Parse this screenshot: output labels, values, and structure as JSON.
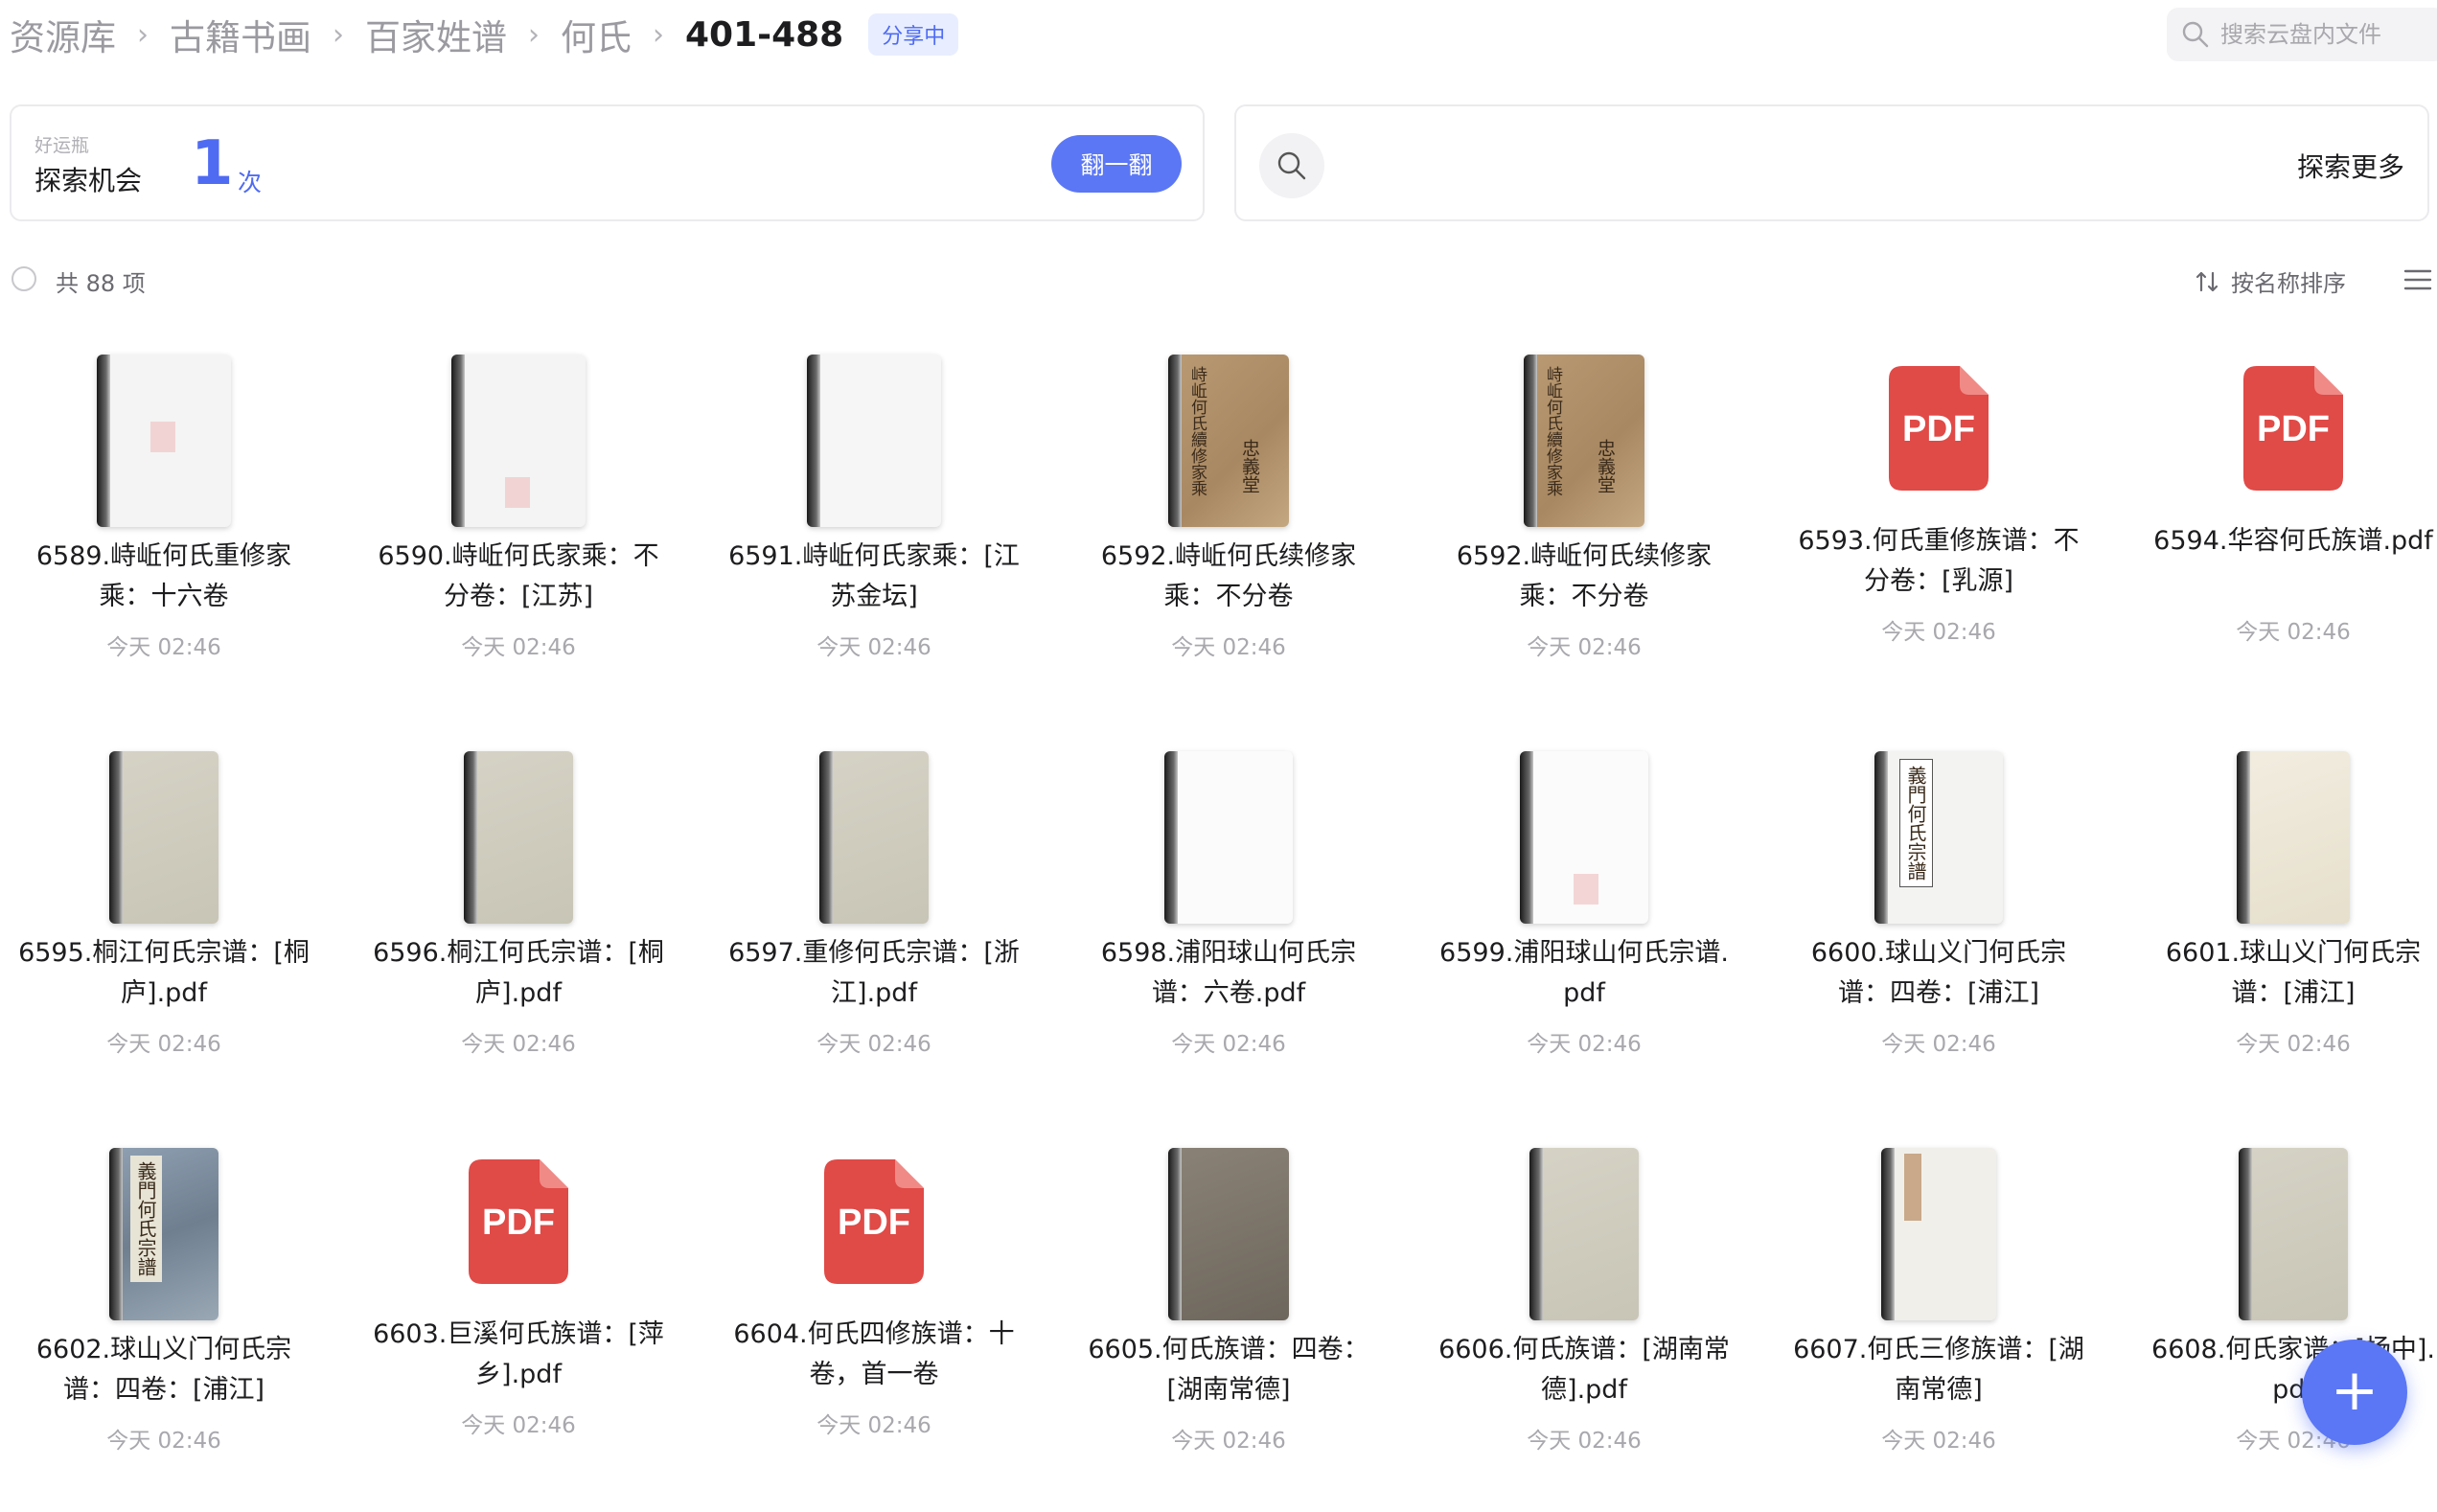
{
  "breadcrumb": {
    "items": [
      "资源库",
      "古籍书画",
      "百家姓谱",
      "何氏"
    ],
    "separator": "›",
    "current": "401-488",
    "badge": "分享中"
  },
  "search": {
    "placeholder": "搜索云盘内文件",
    "icon": "search-icon"
  },
  "lucky": {
    "small_label": "好运瓶",
    "label": "探索机会",
    "count": "1",
    "unit": "次",
    "button": "翻一翻"
  },
  "explore": {
    "label": "探索更多"
  },
  "list": {
    "count_text": "共 88 项",
    "sort_label": "按名称排序"
  },
  "colors": {
    "accent": "#5b77f5",
    "pdf_red": "#e04a47"
  },
  "files": [
    {
      "name": "6589.峙岴何氏重修家乘：十六卷",
      "time": "今天 02:46",
      "thumb": "blank-book",
      "seal_pos": "mid"
    },
    {
      "name": "6590.峙岴何氏家乘：不分卷：[江苏]",
      "time": "今天 02:46",
      "thumb": "blank-book",
      "seal_pos": "bottom"
    },
    {
      "name": "6591.峙岴何氏家乘：[江苏金坛]",
      "time": "今天 02:46",
      "thumb": "blank-book-clean",
      "seal_pos": "none"
    },
    {
      "name": "6592.峙岴何氏续修家乘：不分卷",
      "time": "今天 02:46",
      "thumb": "brown-book",
      "cover_text": "峙岴何氏續修家乘",
      "cover_text2": "忠義堂"
    },
    {
      "name": "6592.峙岴何氏续修家乘：不分卷",
      "time": "今天 02:46",
      "thumb": "brown-book",
      "cover_text": "峙岴何氏續修家乘",
      "cover_text2": "忠義堂"
    },
    {
      "name": "6593.何氏重修族谱：不分卷：[乳源]",
      "time": "今天 02:46",
      "thumb": "pdf",
      "pdf_label": "PDF"
    },
    {
      "name": "6594.华容何氏族谱.pdf",
      "time": "今天 02:46",
      "thumb": "pdf",
      "pdf_label": "PDF"
    },
    {
      "name": "6595.桐江何氏宗谱：[桐庐].pdf",
      "time": "今天 02:46",
      "thumb": "gray-book"
    },
    {
      "name": "6596.桐江何氏宗谱：[桐庐].pdf",
      "time": "今天 02:46",
      "thumb": "gray-book"
    },
    {
      "name": "6597.重修何氏宗谱：[浙江].pdf",
      "time": "今天 02:46",
      "thumb": "gray-book"
    },
    {
      "name": "6598.浦阳球山何氏宗谱：六卷.pdf",
      "time": "今天 02:46",
      "thumb": "white-book"
    },
    {
      "name": "6599.浦阳球山何氏宗谱.pdf",
      "time": "今天 02:46",
      "thumb": "white-book-seal"
    },
    {
      "name": "6600.球山义门何氏宗谱：四卷：[浦江]",
      "time": "今天 02:46",
      "thumb": "label-book",
      "cover_text": "義門何氏宗譜"
    },
    {
      "name": "6601.球山义门何氏宗谱：[浦江]",
      "time": "今天 02:46",
      "thumb": "tan-book"
    },
    {
      "name": "6602.球山义门何氏宗谱：四卷：[浦江]",
      "time": "今天 02:46",
      "thumb": "blue-book",
      "cover_text": "義門何氏宗譜"
    },
    {
      "name": "6603.巨溪何氏族谱：[萍乡].pdf",
      "time": "今天 02:46",
      "thumb": "pdf",
      "pdf_label": "PDF"
    },
    {
      "name": "6604.何氏四修族谱：十卷，首一卷",
      "time": "今天 02:46",
      "thumb": "pdf",
      "pdf_label": "PDF"
    },
    {
      "name": "6605.何氏族谱：四卷：[湖南常德]",
      "time": "今天 02:46",
      "thumb": "dark-book"
    },
    {
      "name": "6606.何氏族谱：[湖南常德].pdf",
      "time": "今天 02:46",
      "thumb": "gray-book"
    },
    {
      "name": "6607.何氏三修族谱：[湖南常德]",
      "time": "今天 02:46",
      "thumb": "red-label-book"
    },
    {
      "name": "6608.何氏家谱：[扬中].pdf",
      "time": "今天 02:46",
      "thumb": "gray-book"
    }
  ]
}
